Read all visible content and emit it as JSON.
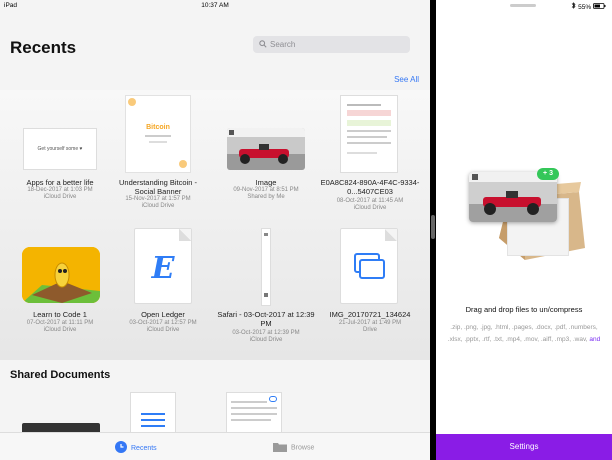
{
  "status": {
    "left": "iPad",
    "time": "10:37 AM",
    "battery": "55%"
  },
  "recents": {
    "title": "Recents",
    "search_placeholder": "Search",
    "see_all": "See All",
    "items": [
      {
        "name": "Apps for a better life",
        "date": "18-Dec-2017 at 1:03 PM",
        "location": "iCloud Drive",
        "thumb_text": "Get yourself some ♥"
      },
      {
        "name": "Understanding Bitcoin - Social Banner",
        "date": "15-Nov-2017 at 1:57 PM",
        "location": "iCloud Drive",
        "thumb_text": "Bitcoin"
      },
      {
        "name": "Image",
        "date": "09-Nov-2017 at 8:51 PM",
        "location": "Shared by Me"
      },
      {
        "name": "E0A8C824-890A-4F4C-9334-0...5407CE03",
        "date": "08-Oct-2017 at 11:45 AM",
        "location": "iCloud Drive"
      },
      {
        "name": "Learn to Code 1",
        "date": "07-Oct-2017 at 11:11 PM",
        "location": "iCloud Drive"
      },
      {
        "name": "Open Ledger",
        "date": "03-Oct-2017 at 12:57 PM",
        "location": "iCloud Drive",
        "thumb_text": "E"
      },
      {
        "name": "Safari - 03-Oct-2017 at 12:39 PM",
        "date": "03-Oct-2017 at 12:39 PM",
        "location": "iCloud Drive"
      },
      {
        "name": "IMG_20170721_134624",
        "date": "21-Jul-2017 at 1:49 PM",
        "location": "Drive"
      }
    ]
  },
  "shared": {
    "title": "Shared Documents"
  },
  "tabbar": {
    "recents": "Recents",
    "browse": "Browse"
  },
  "compress": {
    "badge": "+ 3",
    "drop_text": "Drag and drop files to un/compress",
    "formats": ".zip, .png, .jpg, .html, .pages, .docx, .pdf, .numbers, .xlsx, .pptx, .rtf, .txt, .mp4, .mov, .aiff, .mp3, .wav,",
    "formats_and": "and",
    "settings": "Settings"
  },
  "colors": {
    "accent": "#3477f5",
    "purple": "#8a1ce6",
    "green": "#34c759"
  }
}
